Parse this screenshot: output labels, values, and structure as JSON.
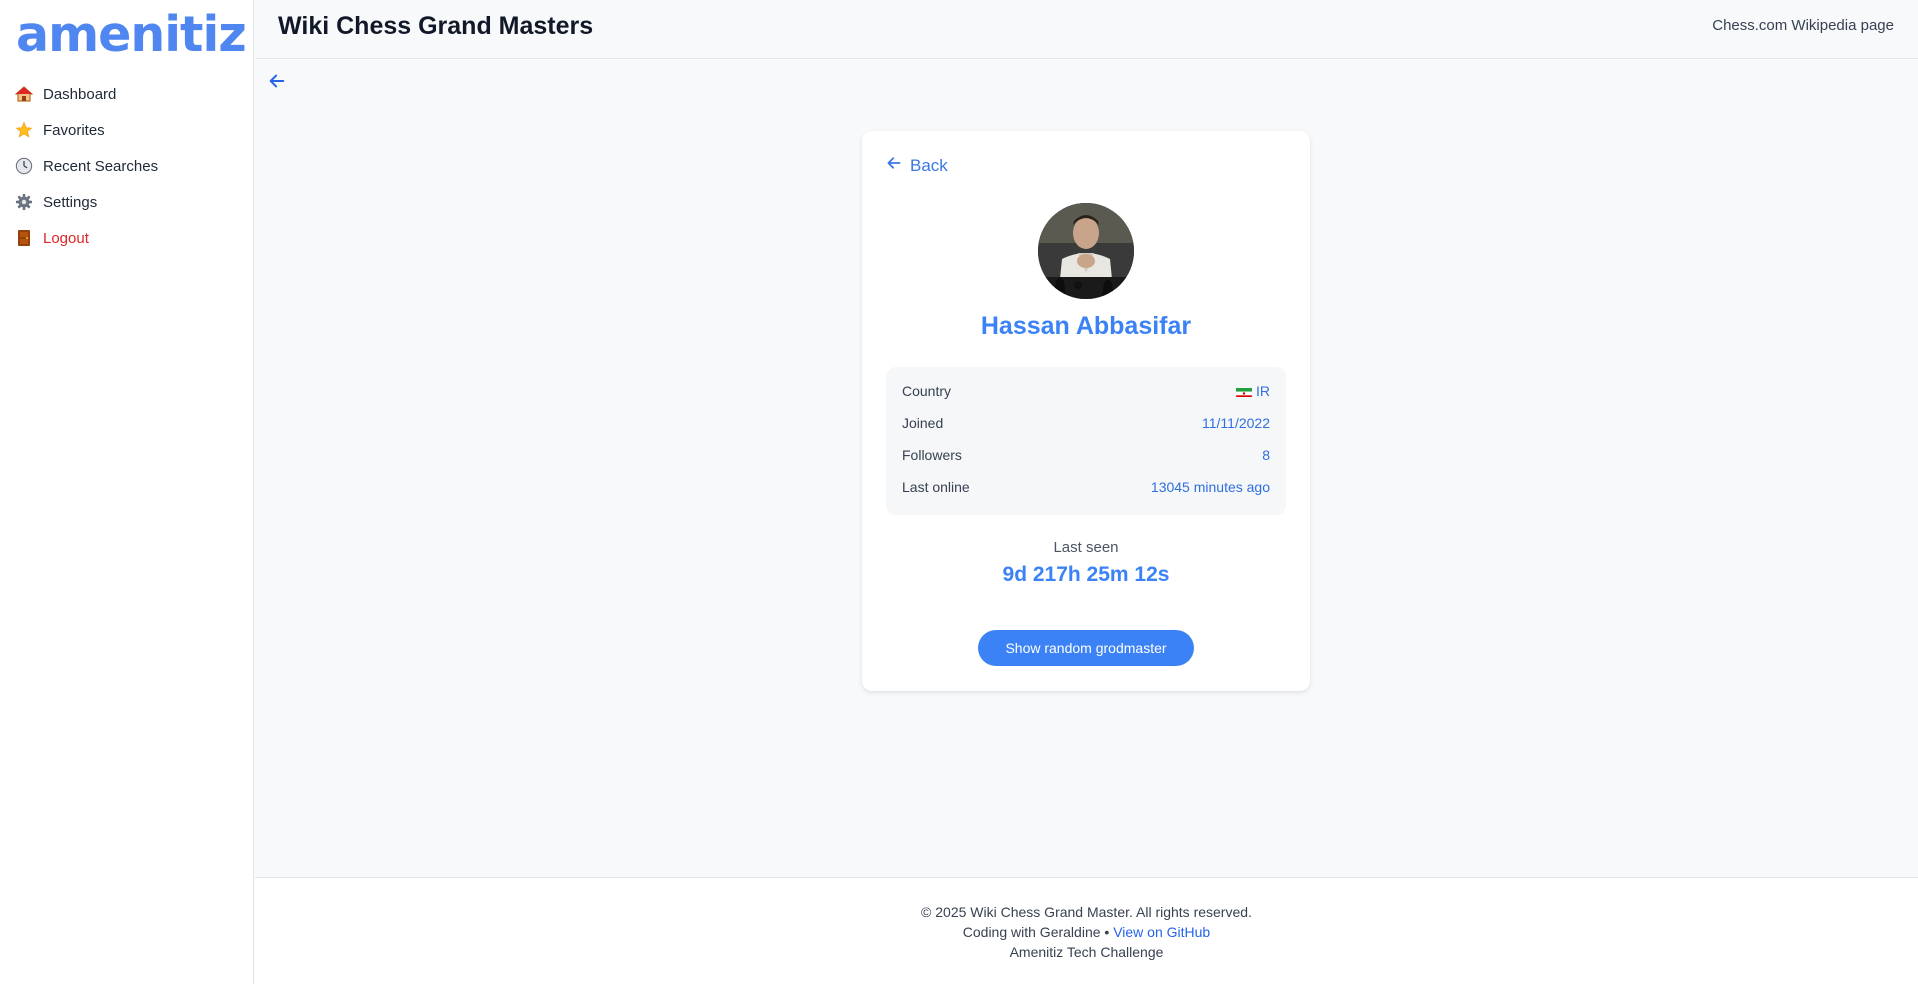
{
  "app": {
    "logo_text": "amenitiz",
    "brand_color": "#4f86f0",
    "accent_color": "#3b82f6"
  },
  "sidebar": {
    "items": [
      {
        "label": "Dashboard",
        "icon": "home-icon"
      },
      {
        "label": "Favorites",
        "icon": "star-icon"
      },
      {
        "label": "Recent Searches",
        "icon": "clock-icon"
      },
      {
        "label": "Settings",
        "icon": "gear-icon"
      },
      {
        "label": "Logout",
        "icon": "door-icon",
        "color": "#dc2626"
      }
    ]
  },
  "header": {
    "title": "Wiki Chess Grand Masters",
    "link": "Chess.com Wikipedia page"
  },
  "profile": {
    "back_label": "Back",
    "name": "Hassan Abbasifar",
    "info": [
      {
        "label": "Country",
        "value": "IR",
        "flag": "iran-flag-icon"
      },
      {
        "label": "Joined",
        "value": "11/11/2022"
      },
      {
        "label": "Followers",
        "value": "8"
      },
      {
        "label": "Last online",
        "value": "13045 minutes ago"
      }
    ],
    "last_seen_label": "Last seen",
    "last_seen_value": "9d 217h 25m 12s",
    "random_button": "Show random grodmaster"
  },
  "footer": {
    "copyright": "© 2025 Wiki Chess Grand Master. All rights reserved.",
    "credit": "Coding with Geraldine",
    "separator": "•",
    "github_link": "View on GitHub",
    "challenge": "Amenitiz Tech Challenge"
  }
}
